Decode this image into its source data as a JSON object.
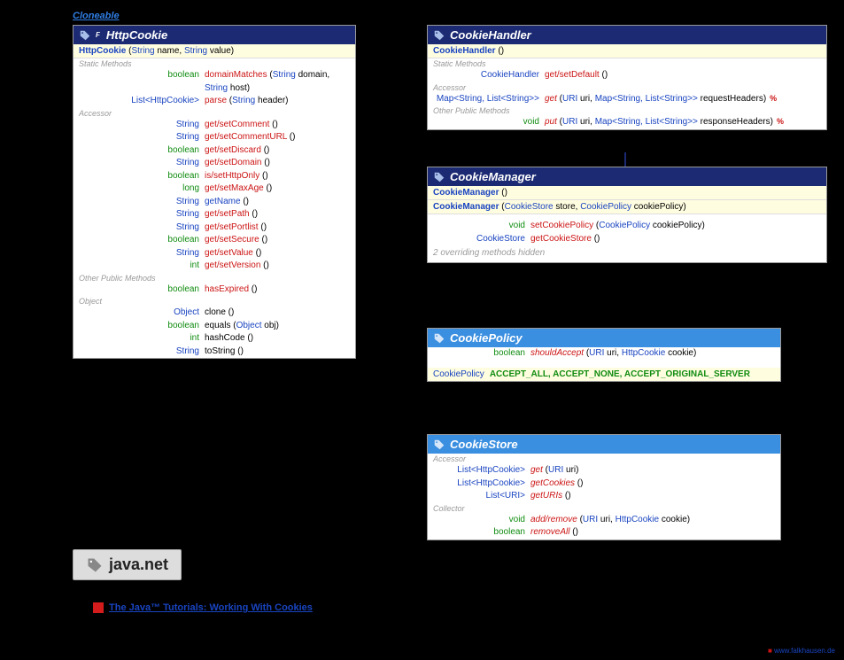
{
  "cloneable_label": "Cloneable",
  "httpcookie": {
    "title": "HttpCookie",
    "sup": "F",
    "constructors": [
      {
        "name": "HttpCookie",
        "params": [
          {
            "t": "String",
            "n": "name"
          },
          {
            "t": "String",
            "n": "value"
          }
        ]
      }
    ],
    "sections": [
      {
        "label": "Static Methods",
        "rows": [
          {
            "ret": "boolean",
            "retc": "green",
            "name": "domainMatches",
            "nc": "red",
            "params": [
              {
                "t": "String",
                "n": "domain"
              },
              {
                "t": "String",
                "n": "host"
              }
            ]
          },
          {
            "ret": "List<HttpCookie>",
            "retc": "blue",
            "name": "parse",
            "nc": "red",
            "params": [
              {
                "t": "String",
                "n": "header"
              }
            ]
          }
        ]
      },
      {
        "label": "Accessor",
        "rows": [
          {
            "ret": "String",
            "retc": "blue",
            "name": "get/setComment",
            "nc": "red",
            "params": []
          },
          {
            "ret": "String",
            "retc": "blue",
            "name": "get/setCommentURL",
            "nc": "red",
            "params": []
          },
          {
            "ret": "boolean",
            "retc": "green",
            "name": "get/setDiscard",
            "nc": "red",
            "params": []
          },
          {
            "ret": "String",
            "retc": "blue",
            "name": "get/setDomain",
            "nc": "red",
            "params": []
          },
          {
            "ret": "boolean",
            "retc": "green",
            "name": "is/setHttpOnly",
            "nc": "red",
            "params": []
          },
          {
            "ret": "long",
            "retc": "green",
            "name": "get/setMaxAge",
            "nc": "red",
            "params": []
          },
          {
            "ret": "String",
            "retc": "blue",
            "name": "getName",
            "nc": "blue",
            "params": []
          },
          {
            "ret": "String",
            "retc": "blue",
            "name": "get/setPath",
            "nc": "red",
            "params": []
          },
          {
            "ret": "String",
            "retc": "blue",
            "name": "get/setPortlist",
            "nc": "red",
            "params": []
          },
          {
            "ret": "boolean",
            "retc": "green",
            "name": "get/setSecure",
            "nc": "red",
            "params": []
          },
          {
            "ret": "String",
            "retc": "blue",
            "name": "get/setValue",
            "nc": "red",
            "params": []
          },
          {
            "ret": "int",
            "retc": "green",
            "name": "get/setVersion",
            "nc": "red",
            "params": []
          }
        ]
      },
      {
        "label": "Other Public Methods",
        "rows": [
          {
            "ret": "boolean",
            "retc": "green",
            "name": "hasExpired",
            "nc": "red",
            "params": []
          }
        ]
      },
      {
        "label": "Object",
        "rows": [
          {
            "ret": "Object",
            "retc": "blue",
            "name": "clone",
            "nc": "black",
            "params": []
          },
          {
            "ret": "boolean",
            "retc": "green",
            "name": "equals",
            "nc": "black",
            "params": [
              {
                "t": "Object",
                "n": "obj"
              }
            ]
          },
          {
            "ret": "int",
            "retc": "green",
            "name": "hashCode",
            "nc": "black",
            "params": []
          },
          {
            "ret": "String",
            "retc": "blue",
            "name": "toString",
            "nc": "black",
            "params": []
          }
        ]
      }
    ]
  },
  "cookiehandler": {
    "title": "CookieHandler",
    "constructors": [
      {
        "name": "CookieHandler",
        "params": []
      }
    ],
    "sections": [
      {
        "label": "Static Methods",
        "rows": [
          {
            "ret": "CookieHandler",
            "retc": "blue",
            "name": "get/setDefault",
            "nc": "red",
            "params": []
          }
        ]
      },
      {
        "label": "Accessor",
        "rows": [
          {
            "ret": "Map<String, List<String>>",
            "retc": "blue",
            "name": "get",
            "nc": "red",
            "ital": true,
            "abs": true,
            "params": [
              {
                "t": "URI",
                "n": "uri"
              },
              {
                "t": "Map<String, List<String>>",
                "n": "requestHeaders"
              }
            ]
          }
        ]
      },
      {
        "label": "Other Public Methods",
        "rows": [
          {
            "ret": "void",
            "retc": "green",
            "name": "put",
            "nc": "red",
            "ital": true,
            "abs": true,
            "params": [
              {
                "t": "URI",
                "n": "uri"
              },
              {
                "t": "Map<String, List<String>>",
                "n": "responseHeaders"
              }
            ]
          }
        ]
      }
    ]
  },
  "cookiemanager": {
    "title": "CookieManager",
    "constructors": [
      {
        "name": "CookieManager",
        "params": []
      },
      {
        "name": "CookieManager",
        "params": [
          {
            "t": "CookieStore",
            "n": "store"
          },
          {
            "t": "CookiePolicy",
            "n": "cookiePolicy"
          }
        ]
      }
    ],
    "rows": [
      {
        "ret": "void",
        "retc": "green",
        "name": "setCookiePolicy",
        "nc": "red",
        "params": [
          {
            "t": "CookiePolicy",
            "n": "cookiePolicy"
          }
        ]
      },
      {
        "ret": "CookieStore",
        "retc": "blue",
        "name": "getCookieStore",
        "nc": "red",
        "params": []
      }
    ],
    "note": "2 overriding methods hidden"
  },
  "cookiepolicy": {
    "title": "CookiePolicy",
    "rows": [
      {
        "ret": "boolean",
        "retc": "green",
        "name": "shouldAccept",
        "nc": "red",
        "ital": true,
        "params": [
          {
            "t": "URI",
            "n": "uri"
          },
          {
            "t": "HttpCookie",
            "n": "cookie"
          }
        ]
      }
    ],
    "constants": {
      "type": "CookiePolicy",
      "vals": "ACCEPT_ALL, ACCEPT_NONE, ACCEPT_ORIGINAL_SERVER"
    }
  },
  "cookiestore": {
    "title": "CookieStore",
    "sections": [
      {
        "label": "Accessor",
        "rows": [
          {
            "ret": "List<HttpCookie>",
            "retc": "blue",
            "name": "get",
            "nc": "red",
            "ital": true,
            "params": [
              {
                "t": "URI",
                "n": "uri"
              }
            ]
          },
          {
            "ret": "List<HttpCookie>",
            "retc": "blue",
            "name": "getCookies",
            "nc": "red",
            "ital": true,
            "params": []
          },
          {
            "ret": "List<URI>",
            "retc": "blue",
            "name": "getURIs",
            "nc": "red",
            "ital": true,
            "params": []
          }
        ]
      },
      {
        "label": "Collector",
        "rows": [
          {
            "ret": "void",
            "retc": "green",
            "name": "add/remove",
            "nc": "red",
            "ital": true,
            "params": [
              {
                "t": "URI",
                "n": "uri"
              },
              {
                "t": "HttpCookie",
                "n": "cookie"
              }
            ]
          },
          {
            "ret": "boolean",
            "retc": "green",
            "name": "removeAll",
            "nc": "red",
            "ital": true,
            "params": []
          }
        ]
      }
    ]
  },
  "pkg_name": "java.net",
  "tutorial_text": "The Java™ Tutorials: Working With Cookies",
  "credit": "www.falkhausen.de"
}
